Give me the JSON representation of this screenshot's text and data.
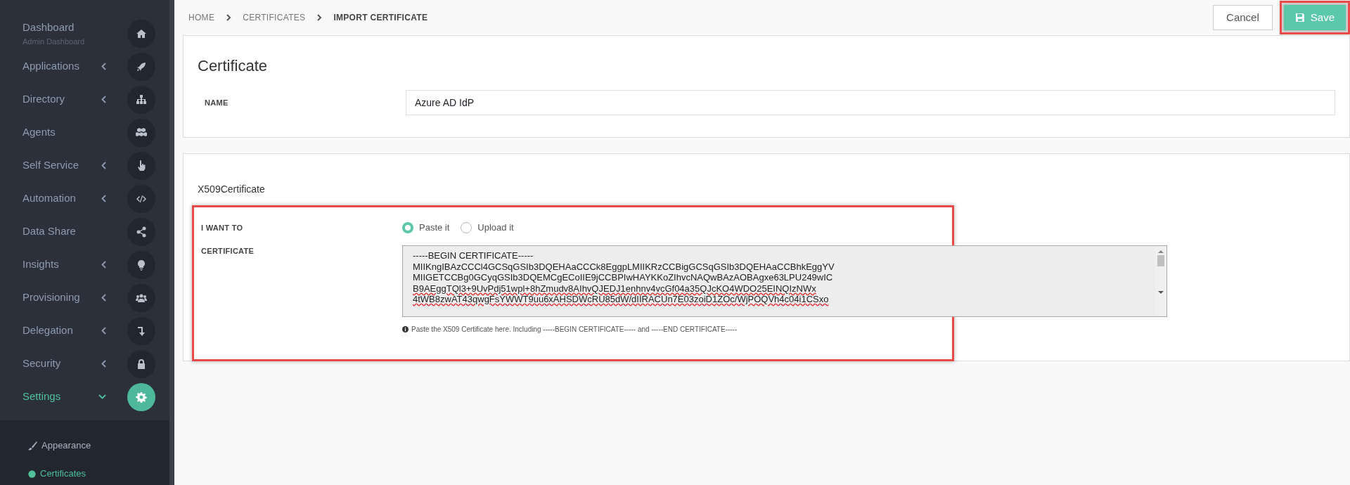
{
  "sidebar": {
    "items": [
      {
        "label": "Dashboard",
        "subtitle": "Admin Dashboard",
        "kind": "link",
        "selected": false
      },
      {
        "label": "Applications",
        "kind": "group",
        "expanded": false,
        "selected": false
      },
      {
        "label": "Directory",
        "kind": "group",
        "expanded": false,
        "selected": false
      },
      {
        "label": "Agents",
        "kind": "link",
        "selected": false
      },
      {
        "label": "Self Service",
        "kind": "group",
        "expanded": false,
        "selected": false
      },
      {
        "label": "Automation",
        "kind": "group",
        "expanded": false,
        "selected": false
      },
      {
        "label": "Data Share",
        "kind": "link",
        "selected": false
      },
      {
        "label": "Insights",
        "kind": "group",
        "expanded": false,
        "selected": false
      },
      {
        "label": "Provisioning",
        "kind": "group",
        "expanded": false,
        "selected": false
      },
      {
        "label": "Delegation",
        "kind": "group",
        "expanded": false,
        "selected": false
      },
      {
        "label": "Security",
        "kind": "group",
        "expanded": false,
        "selected": false
      },
      {
        "label": "Settings",
        "kind": "group",
        "expanded": true,
        "selected": true,
        "children": [
          {
            "label": "Appearance",
            "selected": false
          },
          {
            "label": "Certificates",
            "selected": true
          }
        ]
      }
    ]
  },
  "breadcrumb": [
    {
      "label": "HOME",
      "current": false
    },
    {
      "label": "CERTIFICATES",
      "current": false
    },
    {
      "label": "IMPORT CERTIFICATE",
      "current": true
    }
  ],
  "actions": {
    "cancel": "Cancel",
    "save": {
      "label": "Save",
      "highlighted": true
    }
  },
  "certificate_card": {
    "title": "Certificate",
    "name_label": "NAME",
    "name_value": "Azure AD IdP"
  },
  "x509_card": {
    "title": "X509Certificate",
    "highlighted": true,
    "i_want_to_label": "I WANT TO",
    "options": [
      {
        "label": "Paste it",
        "selected": true
      },
      {
        "label": "Upload it",
        "selected": false
      }
    ],
    "certificate_label": "CERTIFICATE",
    "certificate_lines": [
      "-----BEGIN CERTIFICATE-----",
      "MIIKngIBAzCCCl4GCSqGSIb3DQEHAaCCCk8EggpLMIIKRzCCBigGCSqGSIb3DQEHAaCCBhkEggYV",
      "MIIGETCCBg0GCyqGSIb3DQEMCgECoIIE9jCCBPIwHAYKKoZIhvcNAQwBAzAOBAgxe63LPU249wIC",
      "B9AEggTQl3+9UvPdj51wpl+8hZmudv8AIhvQJEDJ1enhnv4vcGf04a35QJcKO4WDO25EINQIzNWx",
      "4tWB8zwAT43qwgFsYWWT9uu6xAHSDWcRU85dW/dIIRACUn7E03zoiD1ZOc/WjPOQVh4c04i1CSxo"
    ],
    "help": "Paste the X509 Certificate here. Including -----BEGIN CERTIFICATE----- and -----END CERTIFICATE-----"
  }
}
